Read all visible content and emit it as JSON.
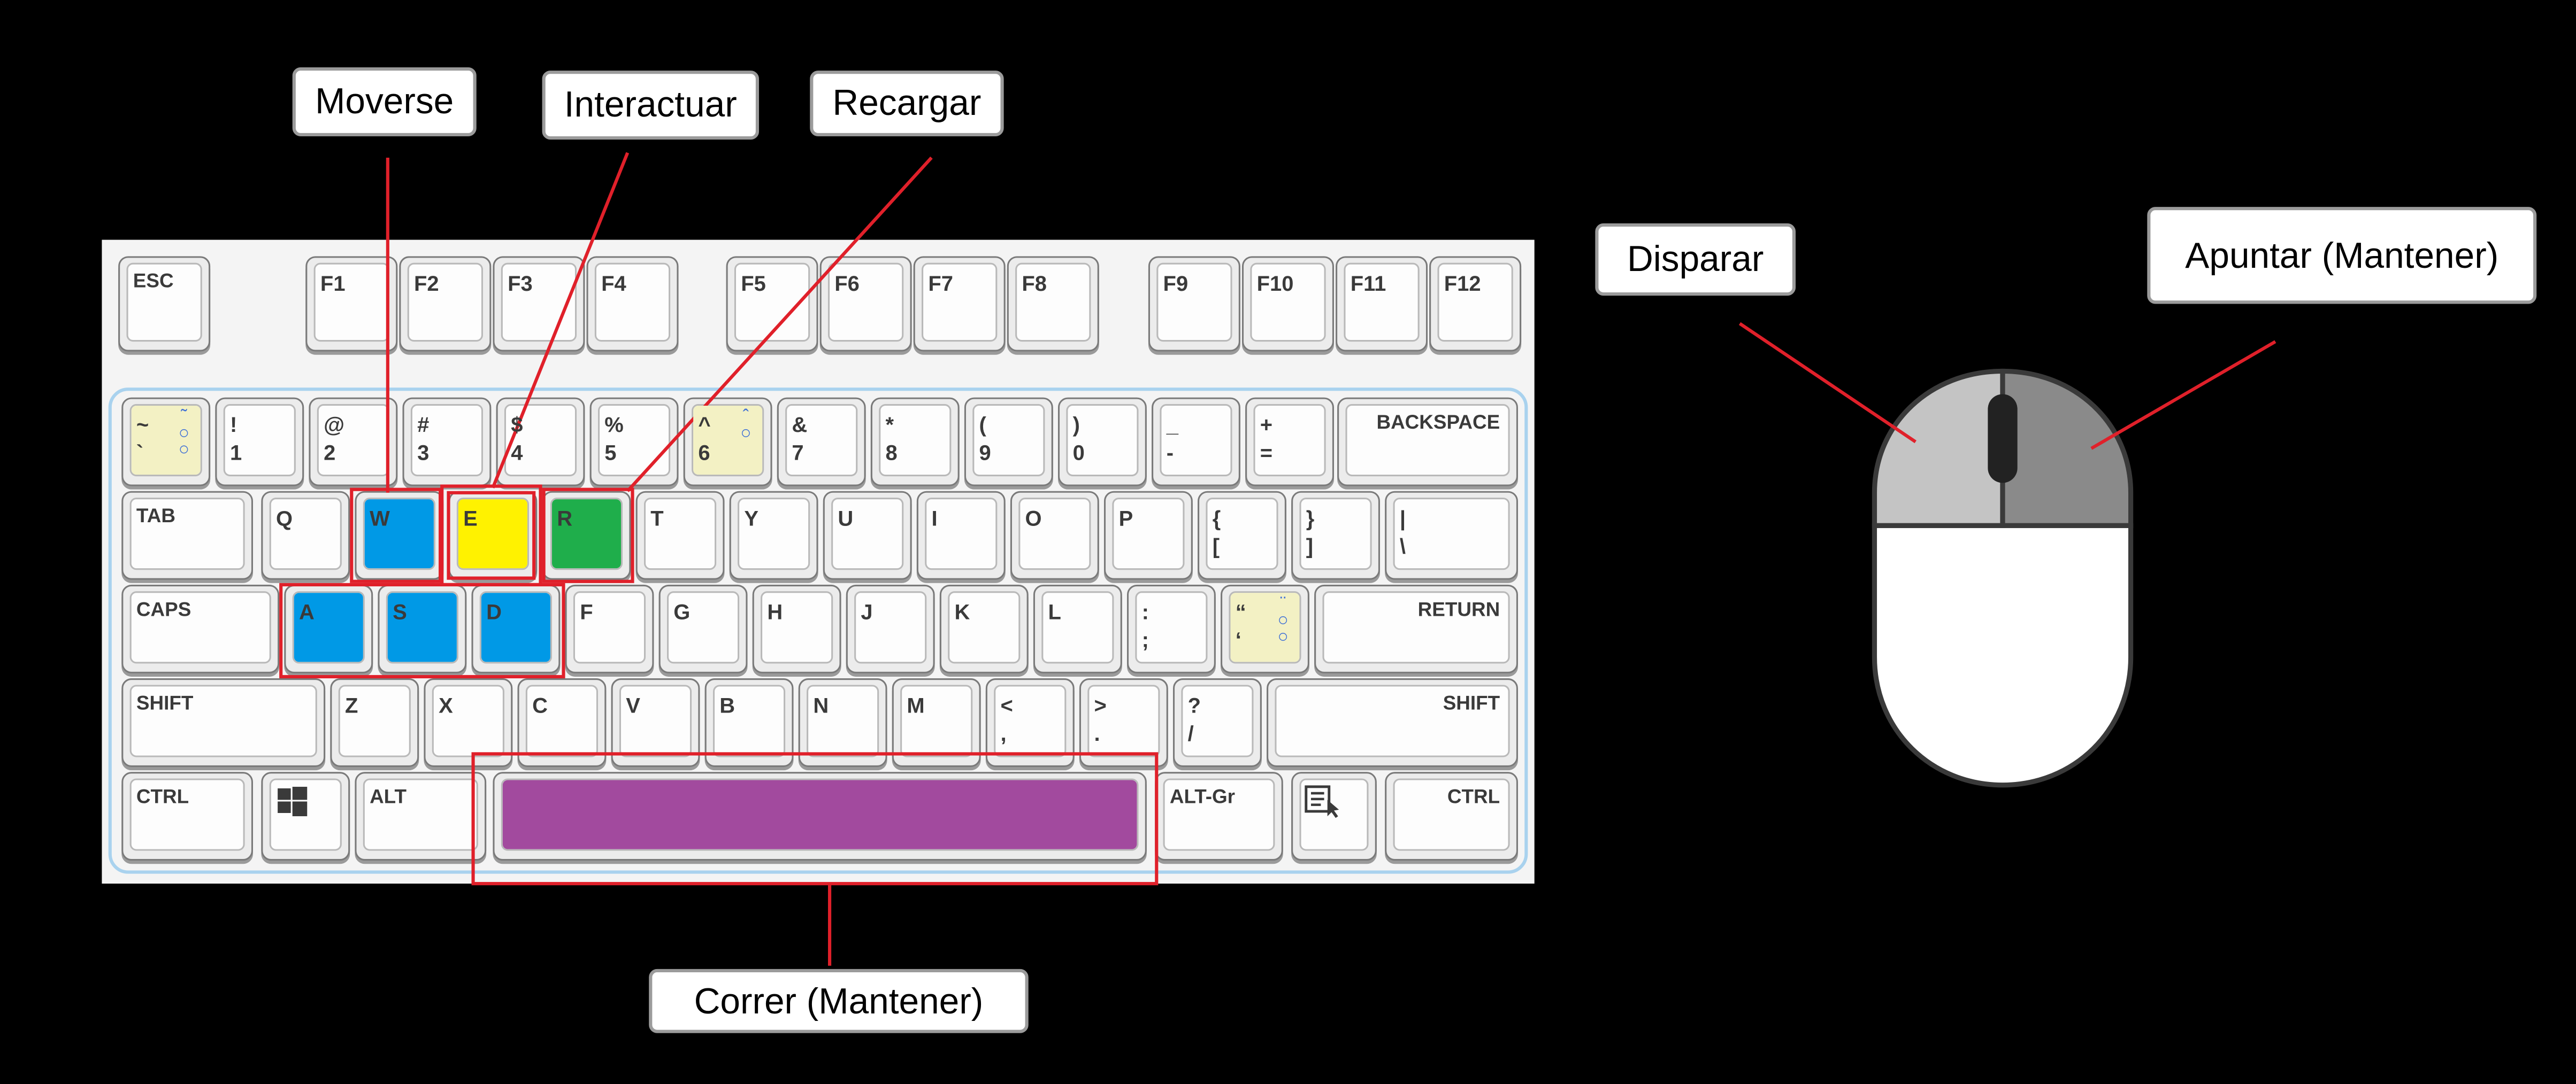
{
  "callouts": {
    "move": "Moverse",
    "interact": "Interactuar",
    "reload": "Recargar",
    "fire": "Disparar",
    "aim": "Apuntar (Mantener)",
    "sprint": "Correr (Mantener)"
  },
  "keys": {
    "esc": "ESC",
    "f1": "F1",
    "f2": "F2",
    "f3": "F3",
    "f4": "F4",
    "f5": "F5",
    "f6": "F6",
    "f7": "F7",
    "f8": "F8",
    "f9": "F9",
    "f10": "F10",
    "f11": "F11",
    "f12": "F12",
    "tilde_top": "~",
    "tilde_bottom": "`",
    "n1_top": "!",
    "n1": "1",
    "n2_top": "@",
    "n2": "2",
    "n3_top": "#",
    "n3": "3",
    "n4_top": "$",
    "n4": "4",
    "n5_top": "%",
    "n5": "5",
    "n6_top": "^",
    "n6": "6",
    "n7_top": "&",
    "n7": "7",
    "n8_top": "*",
    "n8": "8",
    "n9_top": "(",
    "n9": "9",
    "n0_top": ")",
    "n0": "0",
    "minus_top": "_",
    "minus": "-",
    "plus_top": "+",
    "plus": "=",
    "backspace": "BACKSPACE",
    "tab": "TAB",
    "q": "Q",
    "w": "W",
    "e": "E",
    "r": "R",
    "t": "T",
    "y": "Y",
    "u": "U",
    "i": "I",
    "o": "O",
    "p": "P",
    "lbrace_top": "{",
    "lbrace": "[",
    "rbrace_top": "}",
    "rbrace": "]",
    "pipe_top": "|",
    "pipe": "\\",
    "caps": "CAPS",
    "a": "A",
    "s": "S",
    "d": "D",
    "f": "F",
    "g": "G",
    "h": "H",
    "j": "J",
    "k": "K",
    "l": "L",
    "colon_top": ":",
    "colon": ";",
    "quote_top": "“",
    "quote": "‘",
    "return": "RETURN",
    "shift_l": "SHIFT",
    "z": "Z",
    "x": "X",
    "c": "C",
    "v": "V",
    "b": "B",
    "n": "N",
    "m": "M",
    "lt_top": "<",
    "lt": ",",
    "gt_top": ">",
    "gt": ".",
    "q_top": "?",
    "slash": "/",
    "shift_r": "SHIFT",
    "ctrl_l": "CTRL",
    "alt": "ALT",
    "altgr": "ALT-Gr",
    "ctrl_r": "CTRL"
  },
  "colors": {
    "move_keys": "#0099e6",
    "interact_key": "#fff200",
    "reload_key": "#1fae4b",
    "space_key": "#a24a9e",
    "highlight": "#e0202a",
    "mouse_left_button": "#c4c4c4",
    "mouse_right_button": "#8a8a8a"
  },
  "icons": {
    "windows_key": "windows-logo-icon",
    "menu_key": "menu-context-icon",
    "dead_key": "dead-key-marker-icon"
  }
}
